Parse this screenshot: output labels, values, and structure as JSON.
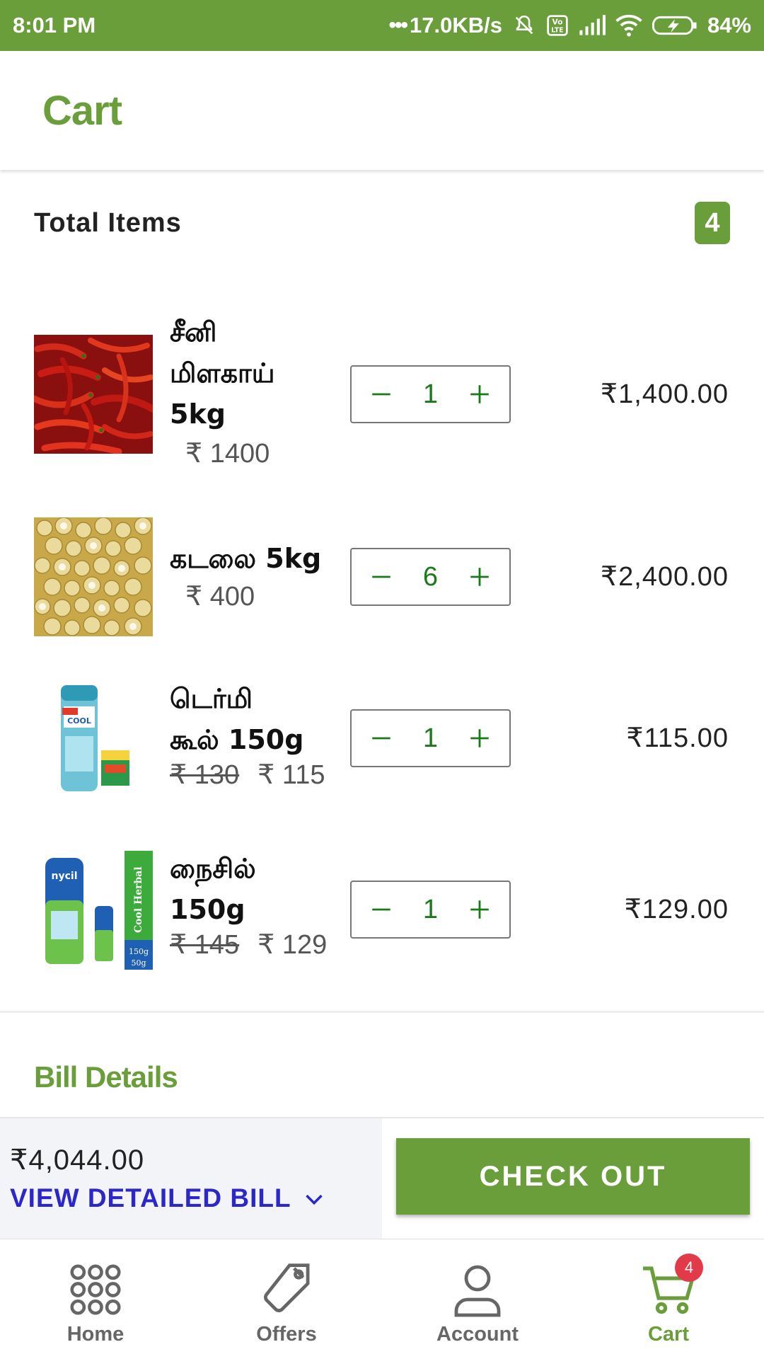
{
  "status_bar": {
    "time": "8:01 PM",
    "network_speed": "17.0KB/s",
    "battery": "84%"
  },
  "app_bar": {
    "title": "Cart"
  },
  "summary": {
    "total_items_label": "Total Items",
    "total_items_count": "4"
  },
  "items": [
    {
      "name_line1": "சீனி",
      "name_line2": "மிளகாய்",
      "name_line3": "5kg",
      "old_price": "",
      "price": "₹ 1400",
      "quantity": "1",
      "line_total": "₹1,400.00"
    },
    {
      "name_line1": "கடலை 5kg",
      "old_price": "",
      "price": "₹ 400",
      "quantity": "6",
      "line_total": "₹2,400.00"
    },
    {
      "name_line1": "டெர்மி",
      "name_line2": "கூல் 150g",
      "old_price": "₹ 130",
      "price": "₹ 115",
      "quantity": "1",
      "line_total": "₹115.00"
    },
    {
      "name_line1": "நைசில்",
      "name_line2": "150g",
      "old_price": "₹ 145",
      "price": "₹ 129",
      "quantity": "1",
      "line_total": "₹129.00"
    }
  ],
  "bill": {
    "title": "Bill Details",
    "grand_total": "₹4,044.00",
    "view_detailed_bill": "VIEW DETAILED BILL",
    "checkout_label": "CHECK OUT"
  },
  "bottom_nav": {
    "items": [
      {
        "label": "Home",
        "icon": "grid-icon"
      },
      {
        "label": "Offers",
        "icon": "tag-icon"
      },
      {
        "label": "Account",
        "icon": "person-icon"
      },
      {
        "label": "Cart",
        "icon": "cart-icon",
        "badge": "4",
        "active": true
      }
    ]
  },
  "colors": {
    "brand_green": "#6a9e3a",
    "link_blue": "#2b27c9",
    "badge_red": "#e33a4a",
    "qty_green": "#1a7a1a"
  }
}
